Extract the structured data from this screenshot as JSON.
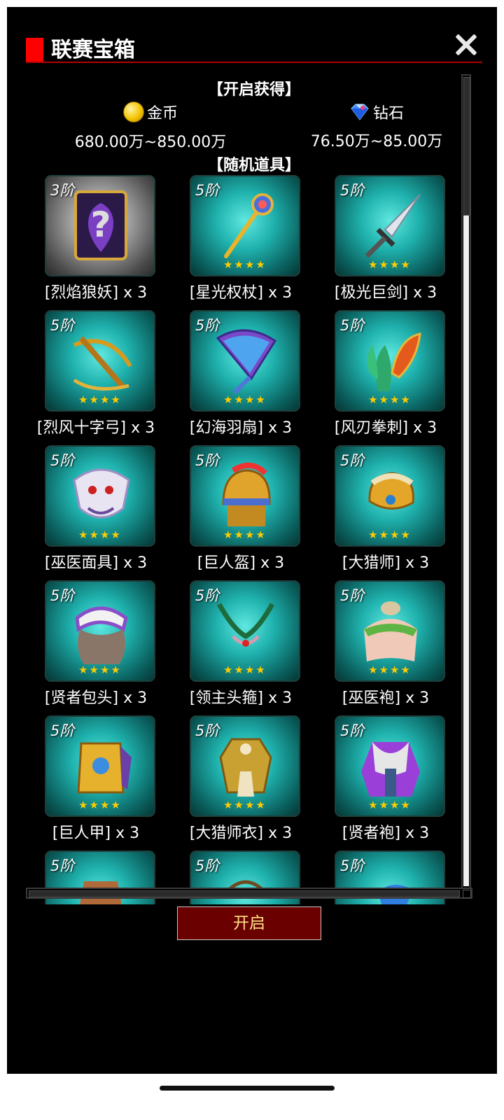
{
  "header": {
    "title": "联赛宝箱",
    "close_icon": "close-icon"
  },
  "rewards": {
    "heading": "【开启获得】",
    "currencies": [
      {
        "name": "金币",
        "icon": "coin-icon",
        "range": "680.00万~850.00万"
      },
      {
        "name": "钻石",
        "icon": "diamond-icon",
        "range": "76.50万~85.00万"
      }
    ]
  },
  "random_items": {
    "heading": "【随机道具】",
    "items": [
      {
        "grade": "3阶",
        "name": "[烈焰狼妖] x 3",
        "stars": "",
        "icon": "mystery-card-icon"
      },
      {
        "grade": "5阶",
        "name": "[星光权杖] x 3",
        "stars": "★★★★",
        "icon": "scepter-icon"
      },
      {
        "grade": "5阶",
        "name": "[极光巨剑] x 3",
        "stars": "★★★★",
        "icon": "greatsword-icon"
      },
      {
        "grade": "5阶",
        "name": "[烈风十字弓] x 3",
        "stars": "★★★★",
        "icon": "crossbow-icon"
      },
      {
        "grade": "5阶",
        "name": "[幻海羽扇] x 3",
        "stars": "★★★★",
        "icon": "feather-fan-icon"
      },
      {
        "grade": "5阶",
        "name": "[风刃拳刺] x 3",
        "stars": "★★★★",
        "icon": "claw-icon"
      },
      {
        "grade": "5阶",
        "name": "[巫医面具] x 3",
        "stars": "★★★★",
        "icon": "shaman-mask-icon"
      },
      {
        "grade": "5阶",
        "name": "[巨人盔] x 3",
        "stars": "★★★★",
        "icon": "helmet-icon"
      },
      {
        "grade": "5阶",
        "name": "[大猎师] x 3",
        "stars": "★★★★",
        "icon": "hat-icon"
      },
      {
        "grade": "5阶",
        "name": "[贤者包头] x 3",
        "stars": "★★★★",
        "icon": "turban-icon"
      },
      {
        "grade": "5阶",
        "name": "[领主头箍] x 3",
        "stars": "★★★★",
        "icon": "circlet-icon"
      },
      {
        "grade": "5阶",
        "name": "[巫医袍] x 3",
        "stars": "★★★★",
        "icon": "robe-icon"
      },
      {
        "grade": "5阶",
        "name": "[巨人甲] x 3",
        "stars": "★★★★",
        "icon": "armor-icon"
      },
      {
        "grade": "5阶",
        "name": "[大猎师衣] x 3",
        "stars": "★★★★",
        "icon": "coat-icon"
      },
      {
        "grade": "5阶",
        "name": "[贤者袍] x 3",
        "stars": "★★★★",
        "icon": "sage-robe-icon"
      },
      {
        "grade": "5阶",
        "name": "",
        "stars": "",
        "icon": "armor-icon"
      },
      {
        "grade": "5阶",
        "name": "",
        "stars": "",
        "icon": "necklace-icon"
      },
      {
        "grade": "5阶",
        "name": "",
        "stars": "",
        "icon": "bracer-icon"
      }
    ]
  },
  "actions": {
    "open_label": "开启"
  },
  "colors": {
    "accent_red": "#ff0000",
    "button_bg": "#6b0000",
    "button_text": "#ffe187",
    "tile_teal": "#1fb1ad",
    "star_gold": "#ffcc00"
  }
}
